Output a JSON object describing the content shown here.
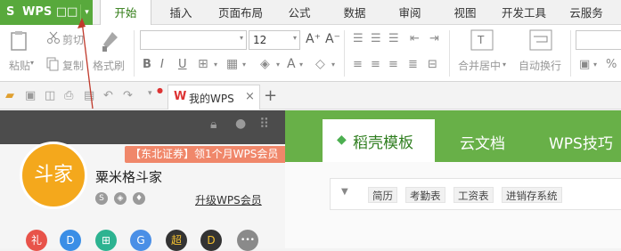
{
  "app": {
    "logo_glyph": "S",
    "title": "WPS □□",
    "menu_arrow": "▾"
  },
  "tabs": [
    "开始",
    "插入",
    "页面布局",
    "公式",
    "数据",
    "审阅",
    "视图",
    "开发工具",
    "云服务"
  ],
  "active_tab": "开始",
  "ribbon": {
    "paste_label": "粘贴",
    "cut_label": "剪切",
    "copy_label": "复制",
    "format_painter_label": "格式刷",
    "font_name_value": "",
    "font_size_value": "12",
    "grow_font": "A⁺",
    "shrink_font": "A⁻",
    "bold": "B",
    "italic": "I",
    "underline": "U",
    "font_color": "A",
    "merge_center_label": "合并居中",
    "wrap_text_label": "自动换行",
    "percent": "%"
  },
  "doc_tab": {
    "label": "我的WPS",
    "close": "×",
    "new": "+"
  },
  "user": {
    "avatar_text": "斗家",
    "name": "粟米格斗家",
    "promo": "【东北证券】领1个月WPS会员",
    "upgrade_link": "升级WPS会员"
  },
  "bottom_icons": [
    {
      "glyph": "礼",
      "color": "#e8534a"
    },
    {
      "glyph": "D",
      "color": "#3a8ee6"
    },
    {
      "glyph": "⊞",
      "color": "#2db391"
    },
    {
      "glyph": "G",
      "color": "#4a8fe6"
    },
    {
      "glyph": "超",
      "color": "#333333"
    },
    {
      "glyph": "D",
      "color": "#333333"
    },
    {
      "glyph": "•••",
      "color": "#8a8a8a"
    }
  ],
  "right_tabs": [
    "稻壳模板",
    "云文档",
    "WPS技巧"
  ],
  "filter_chips": [
    "简历",
    "考勤表",
    "工资表",
    "进销存系统"
  ],
  "colors": {
    "brand_green": "#58a93c",
    "banner_green": "#68b048",
    "avatar_orange": "#f4a81c",
    "promo_salmon": "#f0876a"
  }
}
